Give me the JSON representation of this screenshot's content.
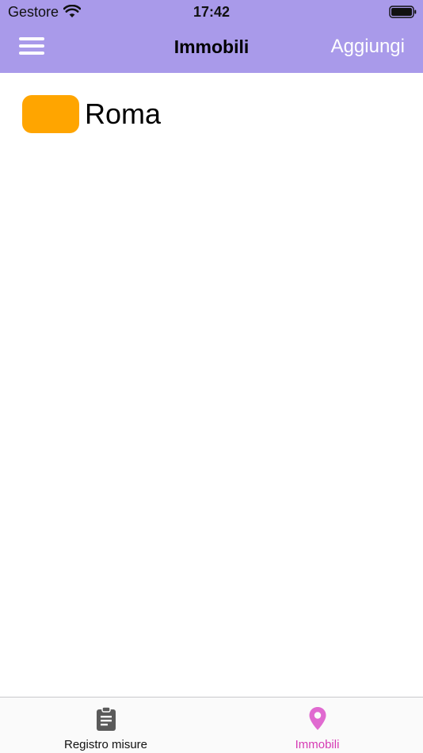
{
  "status_bar": {
    "carrier": "Gestore",
    "time": "17:42"
  },
  "nav": {
    "title": "Immobili",
    "add_label": "Aggiungi"
  },
  "list": [
    {
      "label": "Roma",
      "color": "#ffa500"
    }
  ],
  "tabs": [
    {
      "label": "Registro misure",
      "icon": "clipboard-icon",
      "active": false,
      "color": "#555555"
    },
    {
      "label": "Immobili",
      "icon": "map-pin-icon",
      "active": true,
      "color": "#d63ab4"
    }
  ],
  "colors": {
    "header_bg": "#a99aea",
    "accent": "#d63ab4"
  }
}
